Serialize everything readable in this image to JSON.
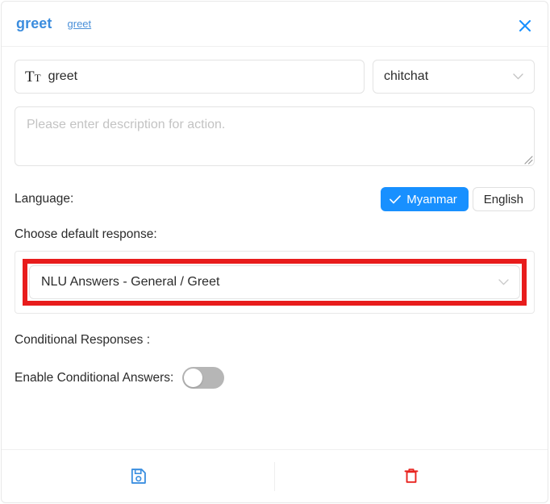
{
  "header": {
    "title": "greet",
    "link": "greet",
    "close_icon": "close-icon"
  },
  "form": {
    "name_icon": "text-format-icon",
    "name_value": "greet",
    "type_value": "chitchat",
    "type_chevron_icon": "chevron-down-icon",
    "description_placeholder": "Please enter description for action.",
    "description_value": "",
    "resize_handle_icon": "resize-grip-icon"
  },
  "language": {
    "label": "Language:",
    "selected": "Myanmar",
    "check_icon": "check-icon",
    "options": [
      {
        "label": "Myanmar",
        "selected": true
      },
      {
        "label": "English",
        "selected": false
      }
    ]
  },
  "response": {
    "choose_label": "Choose default response:",
    "selected": "NLU Answers - General / Greet",
    "chevron_icon": "chevron-down-icon",
    "highlight_color": "#e81c1c"
  },
  "conditional": {
    "section_label": "Conditional Responses :",
    "enable_label": "Enable Conditional Answers:",
    "enabled": false
  },
  "footer": {
    "save_icon": "save-floppy-icon",
    "delete_icon": "trash-delete-icon",
    "save_color": "#3b8fe0",
    "delete_color": "#e8231f"
  }
}
